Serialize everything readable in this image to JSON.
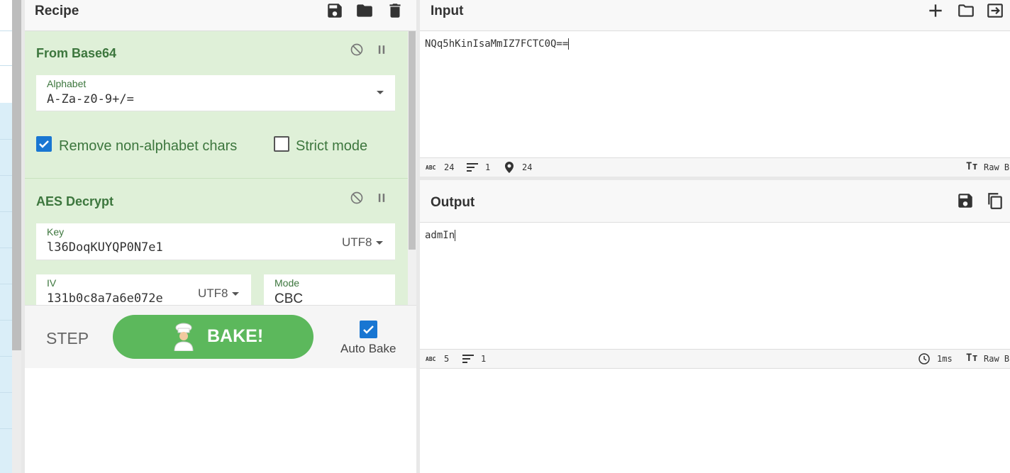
{
  "recipe": {
    "title": "Recipe",
    "operations": [
      {
        "name": "From Base64",
        "alphabet": {
          "label": "Alphabet",
          "value": "A-Za-z0-9+/="
        },
        "remove_non_alphabet": {
          "label": "Remove non-alphabet chars",
          "checked": true
        },
        "strict_mode": {
          "label": "Strict mode",
          "checked": false
        }
      },
      {
        "name": "AES Decrypt",
        "key": {
          "label": "Key",
          "value": "l36DoqKUYQP0N7e1",
          "encoding": "UTF8"
        },
        "iv": {
          "label": "IV",
          "value": "131b0c8a7a6e072e",
          "encoding": "UTF8"
        },
        "mode": {
          "label": "Mode",
          "value": "CBC"
        }
      }
    ],
    "controls": {
      "step_label": "STEP",
      "bake_label": "BAKE!",
      "auto_bake_label": "Auto Bake",
      "auto_bake_checked": true
    }
  },
  "input": {
    "title": "Input",
    "text": "NQq5hKinIsaMmIZ7FCTC0Q==",
    "status": {
      "length": "24",
      "lines": "1",
      "position": "24",
      "mode": "Raw B"
    }
  },
  "output": {
    "title": "Output",
    "text": "admIn",
    "status": {
      "length": "5",
      "lines": "1",
      "time": "1ms",
      "mode": "Raw B"
    }
  },
  "colors": {
    "accent_green": "#5cb85c",
    "op_bg": "#dff0d8",
    "op_text": "#3c763d",
    "checkbox_blue": "#1976d2"
  },
  "icons": [
    "save-icon",
    "folder-icon",
    "trash-icon",
    "disable-icon",
    "pause-icon",
    "plus-icon",
    "open-folder-icon",
    "switch-icon",
    "copy-icon",
    "chef-icon",
    "clock-icon",
    "pin-icon",
    "lines-icon",
    "abc-icon",
    "font-size-icon"
  ]
}
